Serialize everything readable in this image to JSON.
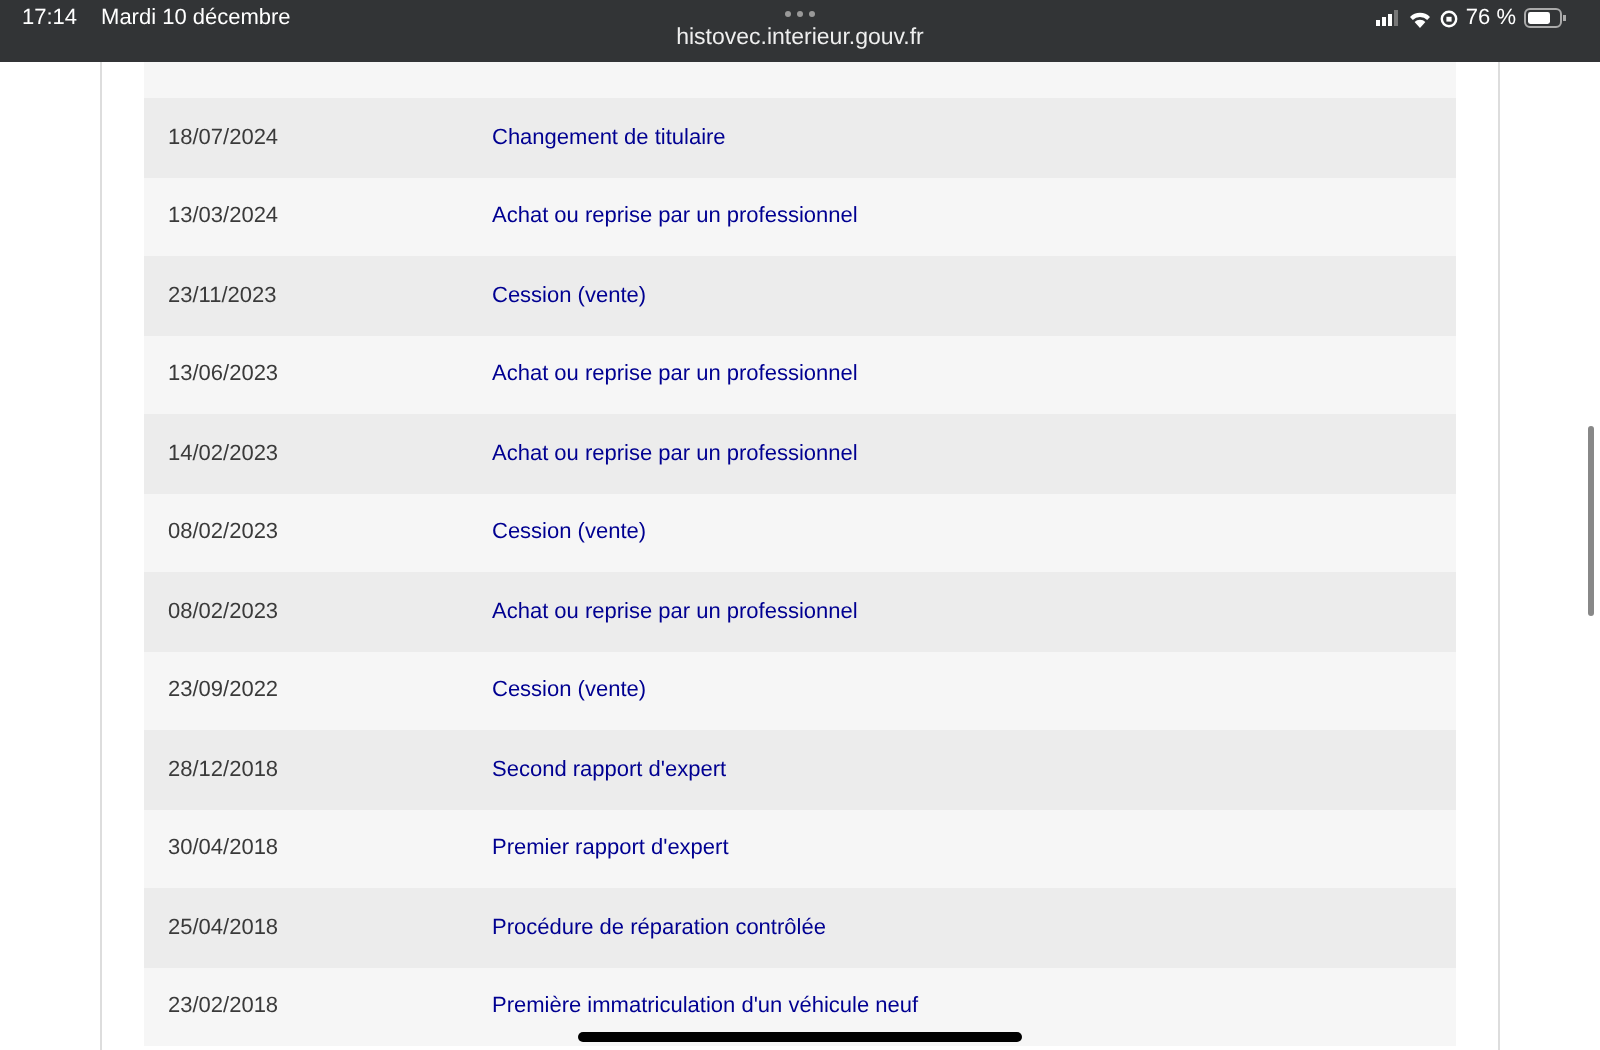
{
  "status_bar": {
    "time": "17:14",
    "date": "Mardi 10 décembre",
    "url": "histovec.interieur.gouv.fr",
    "battery": "76 %"
  },
  "history": [
    {
      "date": "18/07/2024",
      "event": "Changement de titulaire"
    },
    {
      "date": "13/03/2024",
      "event": "Achat ou reprise par un professionnel"
    },
    {
      "date": "23/11/2023",
      "event": "Cession (vente)"
    },
    {
      "date": "13/06/2023",
      "event": "Achat ou reprise par un professionnel"
    },
    {
      "date": "14/02/2023",
      "event": "Achat ou reprise par un professionnel"
    },
    {
      "date": "08/02/2023",
      "event": "Cession (vente)"
    },
    {
      "date": "08/02/2023",
      "event": "Achat ou reprise par un professionnel"
    },
    {
      "date": "23/09/2022",
      "event": "Cession (vente)"
    },
    {
      "date": "28/12/2018",
      "event": "Second rapport d'expert"
    },
    {
      "date": "30/04/2018",
      "event": "Premier rapport d'expert"
    },
    {
      "date": "25/04/2018",
      "event": "Procédure de réparation contrôlée"
    },
    {
      "date": "23/02/2018",
      "event": "Première immatriculation d'un véhicule neuf"
    }
  ]
}
